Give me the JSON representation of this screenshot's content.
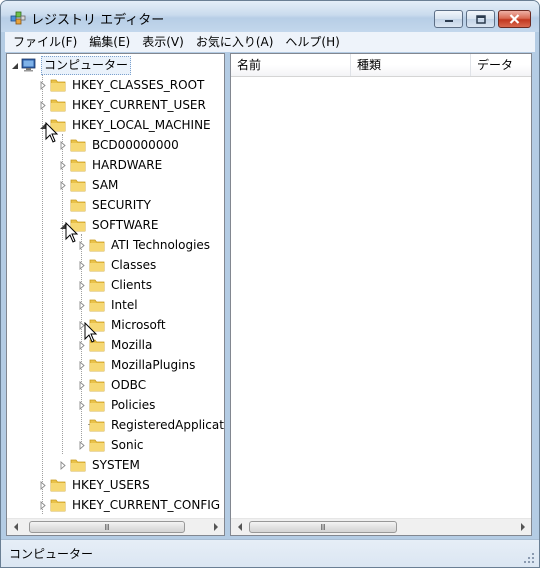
{
  "window": {
    "title": "レジストリ エディター"
  },
  "menu": [
    "ファイル(F)",
    "編集(E)",
    "表示(V)",
    "お気に入り(A)",
    "ヘルプ(H)"
  ],
  "tree": {
    "root": "コンピューター",
    "hkcr": "HKEY_CLASSES_ROOT",
    "hkcu": "HKEY_CURRENT_USER",
    "hklm": "HKEY_LOCAL_MACHINE",
    "bcd": "BCD00000000",
    "hardware": "HARDWARE",
    "sam": "SAM",
    "security": "SECURITY",
    "software": "SOFTWARE",
    "ati": "ATI Technologies",
    "classes": "Classes",
    "clients": "Clients",
    "intel": "Intel",
    "microsoft": "Microsoft",
    "mozilla": "Mozilla",
    "mozillaplugins": "MozillaPlugins",
    "odbc": "ODBC",
    "policies": "Policies",
    "registered": "RegisteredApplications",
    "sonic": "Sonic",
    "system": "SYSTEM",
    "hku": "HKEY_USERS",
    "hkcc": "HKEY_CURRENT_CONFIG"
  },
  "list": {
    "col_name": "名前",
    "col_type": "種類",
    "col_data": "データ"
  },
  "scroll_grip": "Ⅲ",
  "status": "コンピューター",
  "colors": {
    "folder": "#e9c24a",
    "folder_dark": "#c99a1c",
    "selection": "#eaf2fb",
    "close": "#c2371f"
  },
  "icons": [
    "registry-app-icon",
    "minimize-icon",
    "maximize-icon",
    "close-icon",
    "computer-icon",
    "folder-icon",
    "expand-arrow-icon",
    "collapse-arrow-icon",
    "mouse-cursor-icon",
    "resize-grip-icon"
  ]
}
